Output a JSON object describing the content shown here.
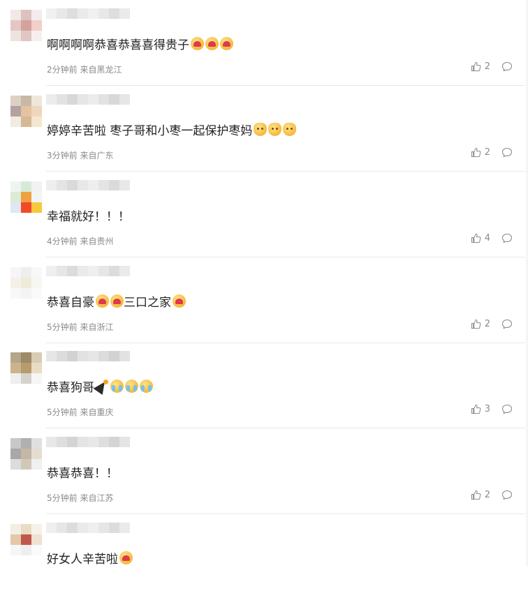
{
  "comments": [
    {
      "text": "啊啊啊啊恭喜恭喜喜得贵子",
      "emojis": [
        "heart",
        "heart",
        "heart"
      ],
      "time": "2分钟前",
      "location": "来自黑龙江",
      "likes": "2",
      "avatar": [
        "#f1e8e7",
        "#dcc2c0",
        "#f4ecec",
        "#e6c6c3",
        "#d4a29d",
        "#f2cfc9",
        "#efe3e2",
        "#e0c7c4",
        "#f6efee"
      ],
      "name": [
        "#f0f0f0",
        "#e8e8e8",
        "#dedede",
        "#eaeaea"
      ]
    },
    {
      "text": "婷婷辛苦啦 枣子哥和小枣一起保护枣妈",
      "emojis": [
        "cat",
        "cat",
        "cat"
      ],
      "time": "3分钟前",
      "location": "来自广东",
      "likes": "2",
      "avatar": [
        "#ddd0c4",
        "#c8b8a6",
        "#efe6dc",
        "#b3a2a0",
        "#e4c3a3",
        "#efd6bc",
        "#f1ebe4",
        "#d7b894",
        "#f5e6cf"
      ],
      "name": [
        "#ececec",
        "#e2e2e2",
        "#d8d8d8",
        "#e6e6e6"
      ]
    },
    {
      "text": "幸福就好！！！",
      "emojis": [],
      "time": "4分钟前",
      "location": "来自贵州",
      "likes": "4",
      "avatar": [
        "#eef5ee",
        "#d7ead7",
        "#f2f2f2",
        "#d8ecd8",
        "#f0a040",
        "#f4f4f4",
        "#dfe8f0",
        "#f04a2a",
        "#f7c93c"
      ],
      "name": [
        "#eeeeee",
        "#e4e4e4",
        "#dadada",
        "#e8e8e8"
      ]
    },
    {
      "text": "恭喜自豪",
      "emojis": [
        "heart",
        "heart"
      ],
      "text2": "三口之家",
      "emojis2": [
        "heart"
      ],
      "time": "5分钟前",
      "location": "来自浙江",
      "likes": "2",
      "avatar": [
        "#f6f6f6",
        "#eeeeee",
        "#f8f8f8",
        "#f4f0e8",
        "#f0ead8",
        "#f8f6f0",
        "#f8f8f8",
        "#f4f4f4",
        "#fafafa"
      ],
      "name": [
        "#efefef",
        "#e6e6e6",
        "#dcdcdc",
        "#eaeaea"
      ]
    },
    {
      "text": "恭喜狗哥",
      "emojis": [
        "party",
        "cry",
        "cry",
        "cry"
      ],
      "time": "5分钟前",
      "location": "来自重庆",
      "likes": "3",
      "avatar": [
        "#b5a68a",
        "#9c8a6a",
        "#d8ccb4",
        "#cbb48c",
        "#b89b6c",
        "#e8dcc4",
        "#efefef",
        "#d6d2cc",
        "#f6f6f6"
      ],
      "name": [
        "#e6e6e6",
        "#dcdcdc",
        "#d2d2d2",
        "#e2e2e2"
      ]
    },
    {
      "text": "恭喜恭喜！！",
      "emojis": [],
      "time": "5分钟前",
      "location": "来自江苏",
      "likes": "2",
      "avatar": [
        "#c8c8c8",
        "#b0b0b0",
        "#e0e0e0",
        "#a8a8a8",
        "#c4b8a4",
        "#e4ddd0",
        "#dcdcdc",
        "#d2c8b8",
        "#f0f0f0"
      ],
      "name": [
        "#e8e8e8",
        "#dedede",
        "#d4d4d4",
        "#e4e4e4"
      ]
    },
    {
      "text": "好女人辛苦啦",
      "emojis": [
        "heart"
      ],
      "time": "",
      "location": "",
      "likes": "",
      "avatar": [
        "#f4eee4",
        "#eadcc4",
        "#f6f2ea",
        "#e4c8a8",
        "#c0584a",
        "#f0e0d0",
        "#f6f6f6",
        "#efefef",
        "#fafafa"
      ],
      "name": [
        "#efefef",
        "#e6e6e6",
        "#dcdcdc",
        "#eaeaea"
      ]
    }
  ]
}
